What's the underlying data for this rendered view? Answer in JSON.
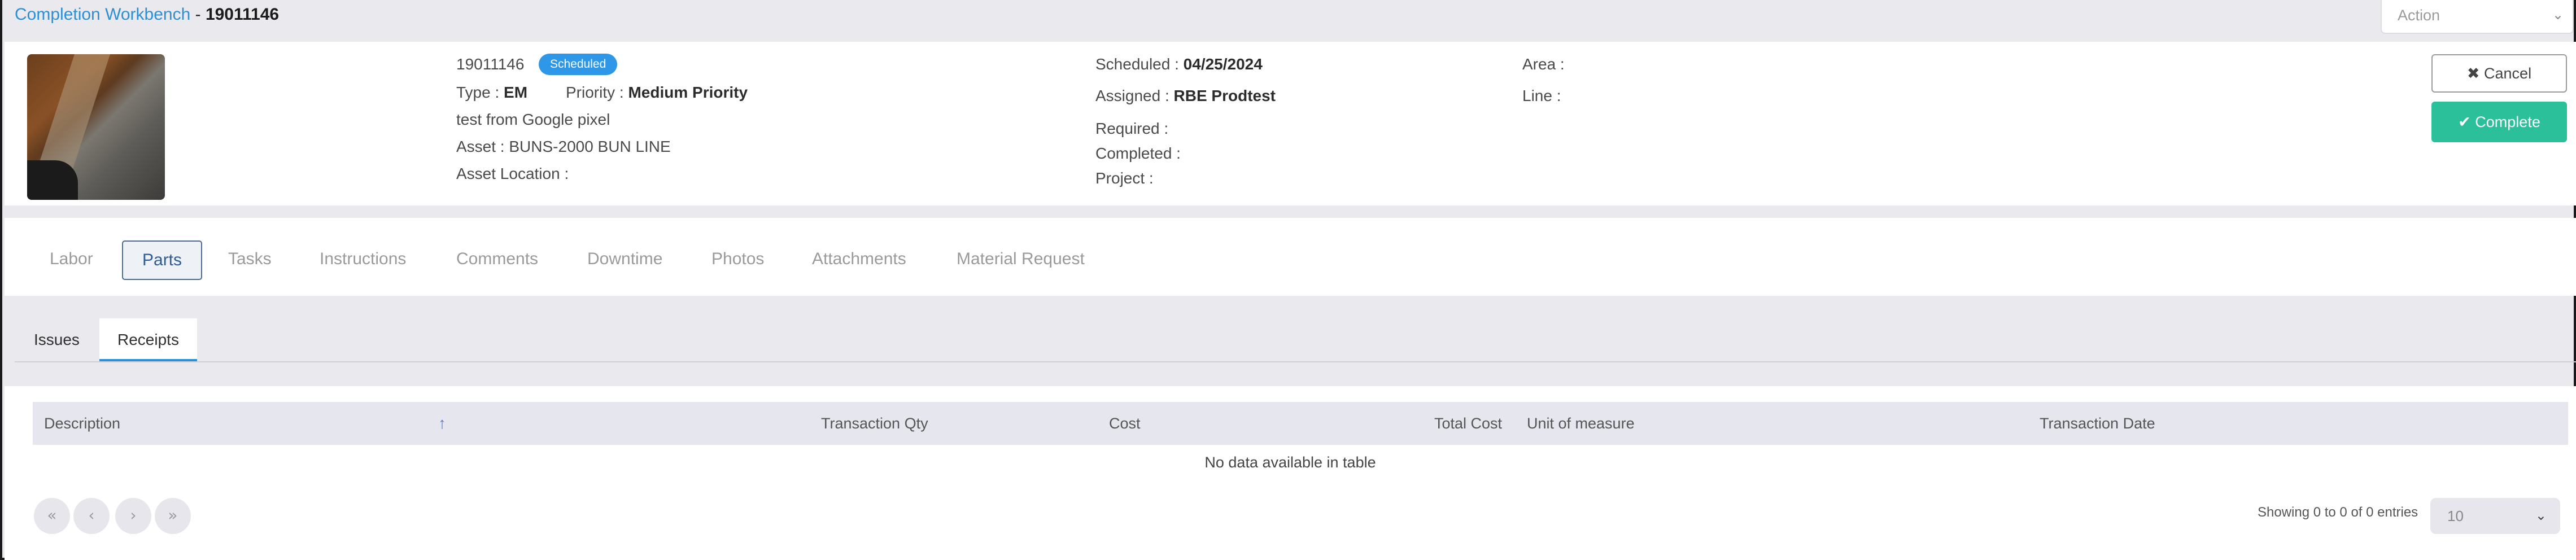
{
  "header": {
    "title_link": "Completion Workbench",
    "title_sep": " - ",
    "title_number": "19011146",
    "action_placeholder": "Action",
    "action_chevron": "⌄"
  },
  "order": {
    "number": "19011146",
    "status": "Scheduled",
    "type_label": "Type :",
    "type_value": "EM",
    "priority_label": "Priority :",
    "priority_value": "Medium Priority",
    "description": "test from Google pixel",
    "asset_label": "Asset :",
    "asset_value": "BUNS-2000 BUN LINE",
    "asset_location_label": "Asset Location :",
    "scheduled_label": "Scheduled :",
    "scheduled_value": "04/25/2024",
    "assigned_label": "Assigned :",
    "assigned_value": "RBE Prodtest",
    "required_label": "Required :",
    "completed_label": "Completed :",
    "project_label": "Project :",
    "area_label": "Area :",
    "line_label": "Line :"
  },
  "buttons": {
    "cancel": "✖ Cancel",
    "complete": "✔ Complete"
  },
  "tabs": [
    {
      "label": "Labor"
    },
    {
      "label": "Parts",
      "active": true
    },
    {
      "label": "Tasks"
    },
    {
      "label": "Instructions"
    },
    {
      "label": "Comments"
    },
    {
      "label": "Downtime"
    },
    {
      "label": "Photos"
    },
    {
      "label": "Attachments"
    },
    {
      "label": "Material Request"
    }
  ],
  "subtabs": [
    {
      "label": "Issues"
    },
    {
      "label": "Receipts",
      "active": true
    }
  ],
  "table": {
    "columns": [
      "Description",
      "Transaction Qty",
      "Cost",
      "Total Cost",
      "Unit of measure",
      "Transaction Date"
    ],
    "sort_icon": "↑",
    "empty_message": "No data available in table",
    "showing": "Showing 0 to 0 of 0 entries",
    "page_size": "10",
    "pager": [
      "«",
      "‹",
      "›",
      "»"
    ],
    "page_size_chevron": "⌄"
  },
  "icons": {
    "cursor": "mouse-pointer-icon",
    "thumbnail": "asset-photo"
  }
}
